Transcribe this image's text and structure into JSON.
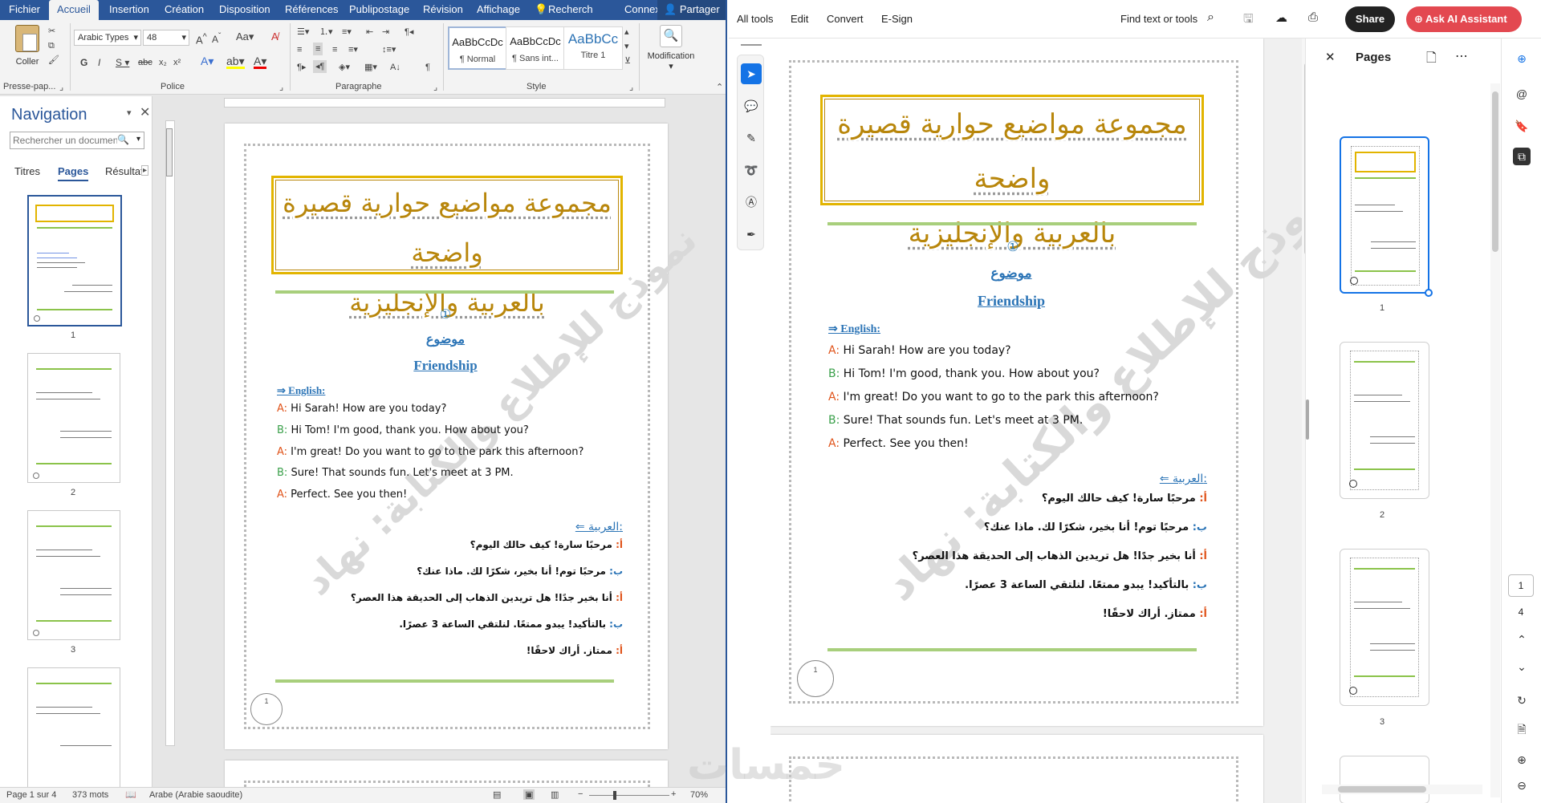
{
  "word": {
    "tabs": [
      "Fichier",
      "Accueil",
      "Insertion",
      "Création",
      "Disposition",
      "Références",
      "Publipostage",
      "Révision",
      "Affichage",
      "Recherch",
      "Connexion",
      "Partager"
    ],
    "active_tab": "Accueil",
    "ribbon": {
      "clipboard": {
        "paste": "Coller",
        "label": "Presse-pap..."
      },
      "font": {
        "name": "Arabic Types",
        "size": "48",
        "label": "Police"
      },
      "paragraph": {
        "label": "Paragraphe"
      },
      "styles": {
        "items": [
          {
            "preview": "AaBbCcDc",
            "name": "¶ Normal"
          },
          {
            "preview": "AaBbCcDc",
            "name": "¶ Sans int..."
          },
          {
            "preview": "AaBbCc",
            "name": "Titre 1"
          }
        ],
        "label": "Style"
      },
      "editing": {
        "label": "Modification"
      }
    },
    "nav": {
      "title": "Navigation",
      "search_placeholder": "Rechercher un document",
      "tabs": [
        "Titres",
        "Pages",
        "Résultat"
      ],
      "active_tab": "Pages",
      "thumbs": [
        "1",
        "2",
        "3"
      ]
    },
    "status": {
      "page": "Page 1 sur 4",
      "words": "373 mots",
      "lang": "Arabe (Arabie saoudite)",
      "zoom": "70%"
    }
  },
  "document": {
    "title_line1": "مجموعة مواضيع حوارية قصيرة واضحة",
    "title_line2": "بالعربية والإنجليزية",
    "number": "①",
    "topic_ar": "موضوع",
    "topic_en": "Friendship",
    "english_heading": "⇒ English:",
    "english_lines": [
      {
        "speaker": "A:",
        "text": " Hi Sarah! How are you today?"
      },
      {
        "speaker": "B:",
        "text": " Hi Tom! I'm good, thank you. How about you?"
      },
      {
        "speaker": "A:",
        "text": " I'm great! Do you want to go to the park this afternoon?"
      },
      {
        "speaker": "B:",
        "text": " Sure! That sounds fun. Let's meet at 3 PM."
      },
      {
        "speaker": "A:",
        "text": " Perfect. See you then!"
      }
    ],
    "arabic_heading": "⇐ العربية:",
    "arabic_lines": [
      {
        "speaker": "أ:",
        "text": " مرحبًا سارة! كيف حالك اليوم؟"
      },
      {
        "speaker": "ب:",
        "text": " مرحبًا توم! أنا بخير، شكرًا لك. ماذا عنك؟"
      },
      {
        "speaker": "أ:",
        "text": " أنا بخير جدًا! هل تريدين الذهاب إلى الحديقة هذا العصر؟"
      },
      {
        "speaker": "ب:",
        "text": " بالتأكيد! يبدو ممتعًا. لنلتقي الساعة 3 عصرًا."
      },
      {
        "speaker": "أ:",
        "text": " ممتاز. أراك لاحقًا!"
      }
    ],
    "page_number": "1",
    "watermark": "نموذج للإطلاع والكتابة: نهاد"
  },
  "acrobat": {
    "menu": [
      "All tools",
      "Edit",
      "Convert",
      "E-Sign"
    ],
    "find": "Find text or tools",
    "share": "Share",
    "ai": "Ask AI Assistant",
    "pages_panel": {
      "title": "Pages",
      "thumbs": [
        "1",
        "2",
        "3"
      ]
    },
    "page_box": "1",
    "page_total": "4"
  },
  "overlay_watermark": "خمسات",
  "colors": {
    "word_blue": "#2b579a",
    "acrobat_blue": "#1473e6",
    "ai_red": "#e34850",
    "gold": "#e2b400",
    "green_rule": "#a8cf7c"
  }
}
